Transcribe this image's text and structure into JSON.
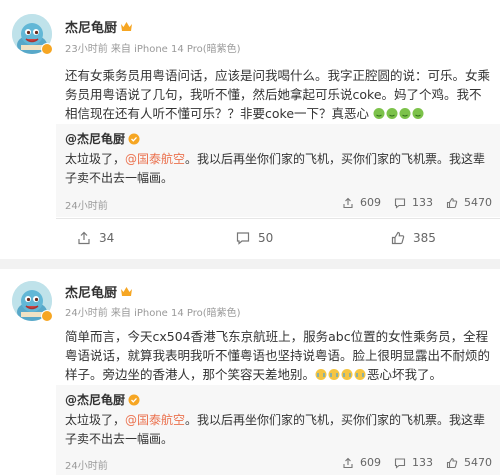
{
  "colors": {
    "link": "#eb7350",
    "verify": "#f6a623",
    "emoji": "#7cc24a"
  },
  "posts": [
    {
      "author": "杰尼龟厨",
      "meta": "23小时前 来自 iPhone 14 Pro(暗紫色)",
      "text": "还有女乘务员用粤语问话，应该是问我喝什么。我字正腔圆的说：可乐。女乘务员用粤语说了几句，我听不懂，然后她拿起可乐说coke。妈了个鸡。我不相信现在还有人听不懂可乐？？非要coke一下？真恶心",
      "repost": {
        "author": "@杰尼龟厨",
        "text_prefix": "太垃圾了，",
        "mention": "@国泰航空",
        "text_suffix": "。我以后再坐你们家的飞机，买你们家的飞机票。我这辈子卖不出去一幅画。",
        "time": "24小时前",
        "share_count": "609",
        "comment_count": "133",
        "like_count": "5470"
      },
      "share_count": "34",
      "comment_count": "50",
      "like_count": "385"
    },
    {
      "author": "杰尼龟厨",
      "meta": "24小时前 来自 iPhone 14 Pro(暗紫色)",
      "text": "简单而言，今天cx504香港飞东京航班上，服务abc位置的女性乘务员，全程粤语说话，就算我表明我听不懂粤语也坚持说粤语。脸上很明显露出不耐烦的样子。旁边坐的香港人，那个笑容天差地别。",
      "text_tail": "恶心坏我了。",
      "repost": {
        "author": "@杰尼龟厨",
        "text_prefix": "太垃圾了，",
        "mention": "@国泰航空",
        "text_suffix": "。我以后再坐你们家的飞机，买你们家的飞机票。我这辈子卖不出去一幅画。",
        "time": "24小时前",
        "share_count": "609",
        "comment_count": "133",
        "like_count": "5470"
      }
    }
  ]
}
